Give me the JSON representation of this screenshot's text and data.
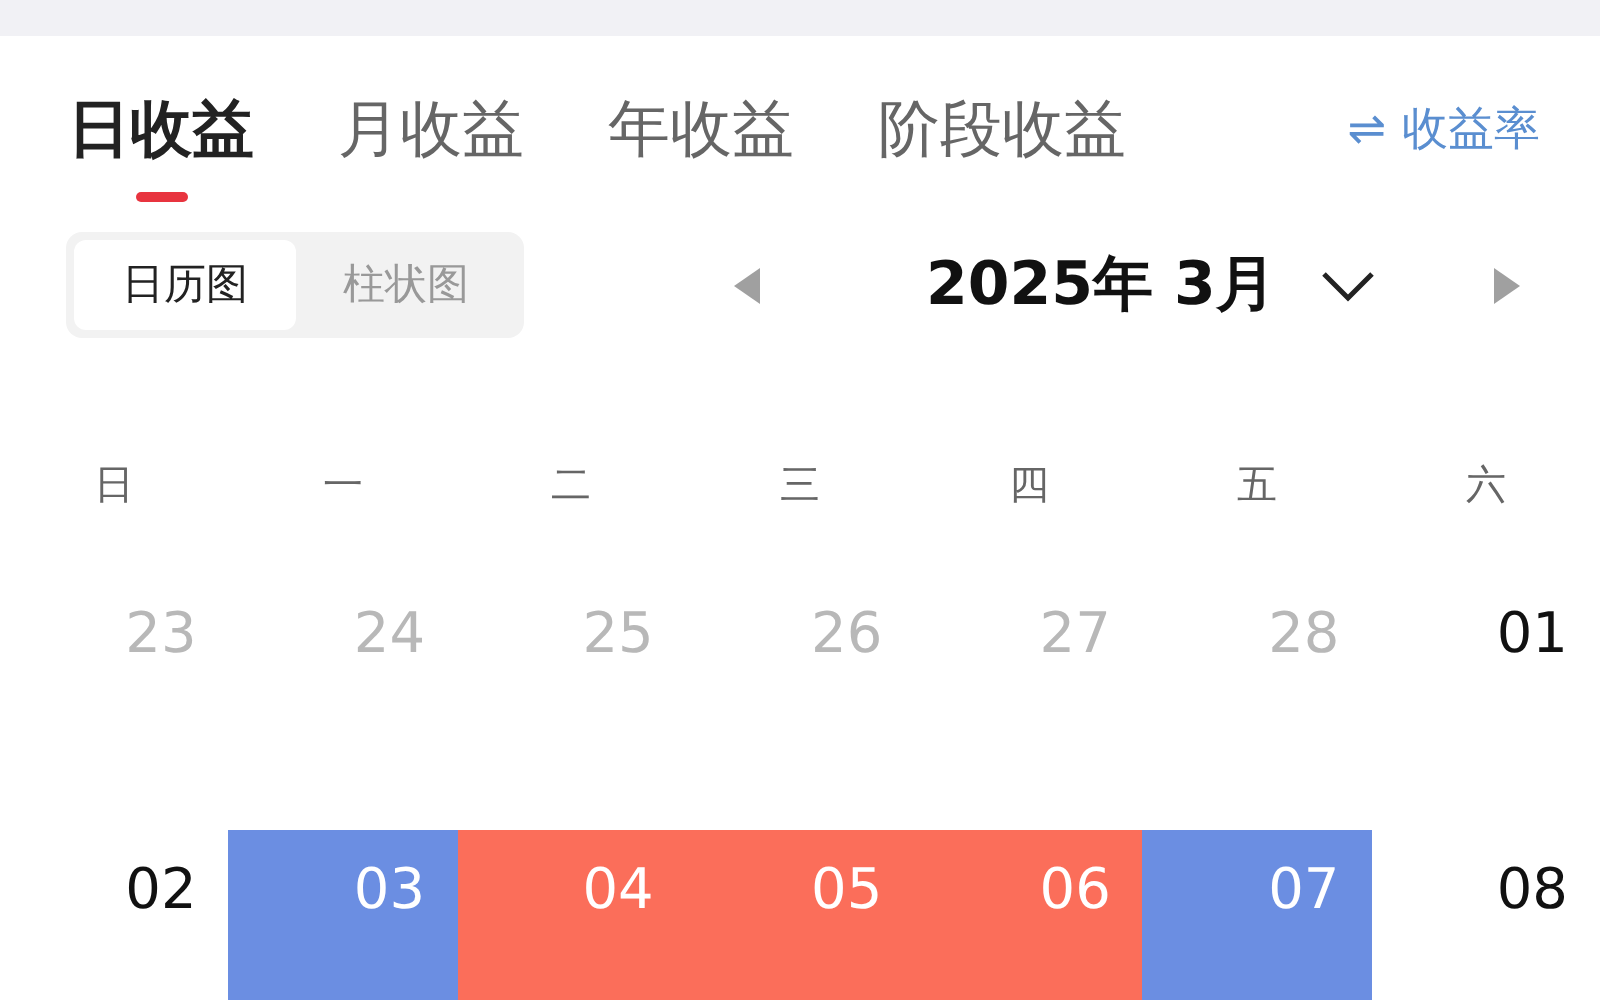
{
  "tabs": [
    {
      "label": "日收益",
      "selected": true
    },
    {
      "label": "月收益",
      "selected": false
    },
    {
      "label": "年收益",
      "selected": false
    },
    {
      "label": "阶段收益",
      "selected": false
    }
  ],
  "rate_link": {
    "icon": "⇌",
    "label": "收益率"
  },
  "view_toggle": [
    {
      "label": "日历图",
      "selected": true
    },
    {
      "label": "柱状图",
      "selected": false
    }
  ],
  "month": {
    "title": "2025年 3月"
  },
  "weekdays": [
    "日",
    "一",
    "二",
    "三",
    "四",
    "五",
    "六"
  ],
  "weeks": [
    [
      {
        "day": "23",
        "muted": true
      },
      {
        "day": "24",
        "muted": true
      },
      {
        "day": "25",
        "muted": true
      },
      {
        "day": "26",
        "muted": true
      },
      {
        "day": "27",
        "muted": true
      },
      {
        "day": "28",
        "muted": true
      },
      {
        "day": "01",
        "muted": false
      }
    ],
    [
      {
        "day": "02",
        "muted": false
      },
      {
        "day": "03",
        "color": "#6b8ee2"
      },
      {
        "day": "04",
        "color": "#fb6e5a"
      },
      {
        "day": "05",
        "color": "#fb6e5a"
      },
      {
        "day": "06",
        "color": "#fb6e5a"
      },
      {
        "day": "07",
        "color": "#6b8ee2"
      },
      {
        "day": "08",
        "muted": false
      }
    ]
  ]
}
